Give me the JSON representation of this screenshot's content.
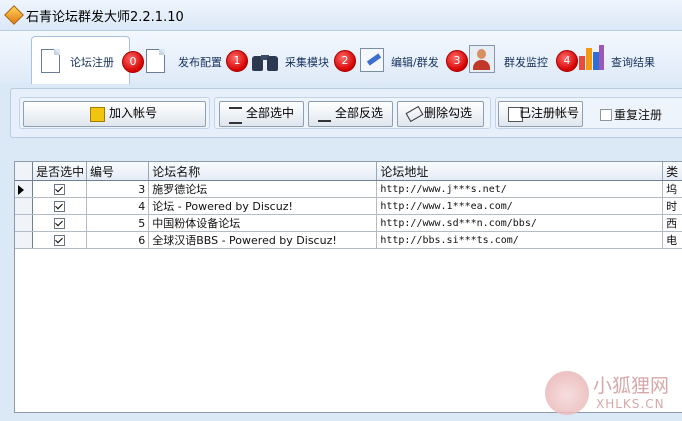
{
  "window": {
    "title": "石青论坛群发大师2.2.1.10"
  },
  "tabs": [
    {
      "label": "论坛注册",
      "badge": "0"
    },
    {
      "label": "发布配置",
      "badge": "1"
    },
    {
      "label": "采集模块",
      "badge": "2"
    },
    {
      "label": "编辑/群发",
      "badge": "3"
    },
    {
      "label": "群发监控",
      "badge": "4"
    },
    {
      "label": "查询结果"
    }
  ],
  "toolbar": {
    "add_account": "加入帐号",
    "select_all": "全部选中",
    "invert_select": "全部反选",
    "delete_checked": "删除勾选",
    "registered_accounts": "已注册帐号",
    "repeat_register": "重复注册"
  },
  "grid": {
    "columns": [
      "是否选中",
      "编号",
      "论坛名称",
      "论坛地址",
      "类"
    ],
    "rows": [
      {
        "selected": true,
        "id": "3",
        "name": "施罗德论坛",
        "url": "http://www.j***s.net/",
        "type": "坞"
      },
      {
        "selected": true,
        "id": "4",
        "name": "论坛 -  Powered by Discuz!",
        "url": "http://www.1***ea.com/",
        "type": "时"
      },
      {
        "selected": true,
        "id": "5",
        "name": "中国粉体设备论坛",
        "url": "http://www.sd***n.com/bbs/",
        "type": "西"
      },
      {
        "selected": true,
        "id": "6",
        "name": " 全球汉语BBS  - Powered by Discuz!",
        "url": "http://bbs.si***ts.com/",
        "type": "电"
      }
    ]
  },
  "watermark": {
    "cn": "小狐狸网",
    "en": "XHLKS.CN"
  }
}
